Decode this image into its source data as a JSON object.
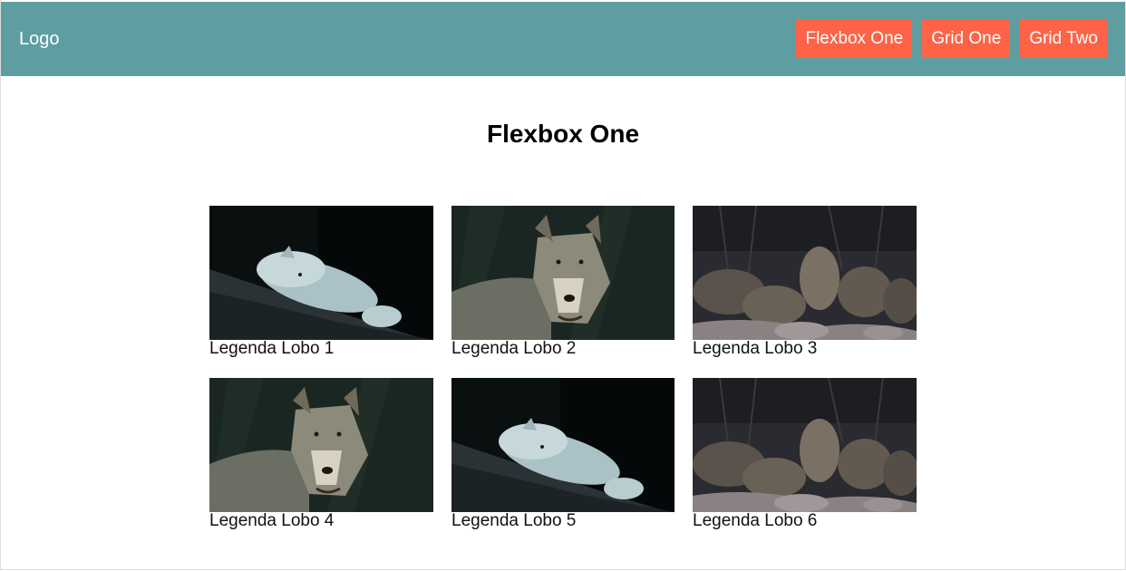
{
  "header": {
    "logo": "Logo",
    "nav": [
      {
        "label": "Flexbox One"
      },
      {
        "label": "Grid One"
      },
      {
        "label": "Grid Two"
      }
    ]
  },
  "main": {
    "title": "Flexbox One",
    "figures": [
      {
        "caption": "Legenda Lobo 1",
        "scene": "white-wolf-lying"
      },
      {
        "caption": "Legenda Lobo 2",
        "scene": "grey-wolf-portrait"
      },
      {
        "caption": "Legenda Lobo 3",
        "scene": "wolf-pack"
      },
      {
        "caption": "Legenda Lobo 4",
        "scene": "grey-wolf-portrait"
      },
      {
        "caption": "Legenda Lobo 5",
        "scene": "white-wolf-lying"
      },
      {
        "caption": "Legenda Lobo 6",
        "scene": "wolf-pack"
      }
    ]
  },
  "colors": {
    "header_bg": "#5f9ea0",
    "nav_button_bg": "#ff6347",
    "nav_text": "#ffffff"
  }
}
